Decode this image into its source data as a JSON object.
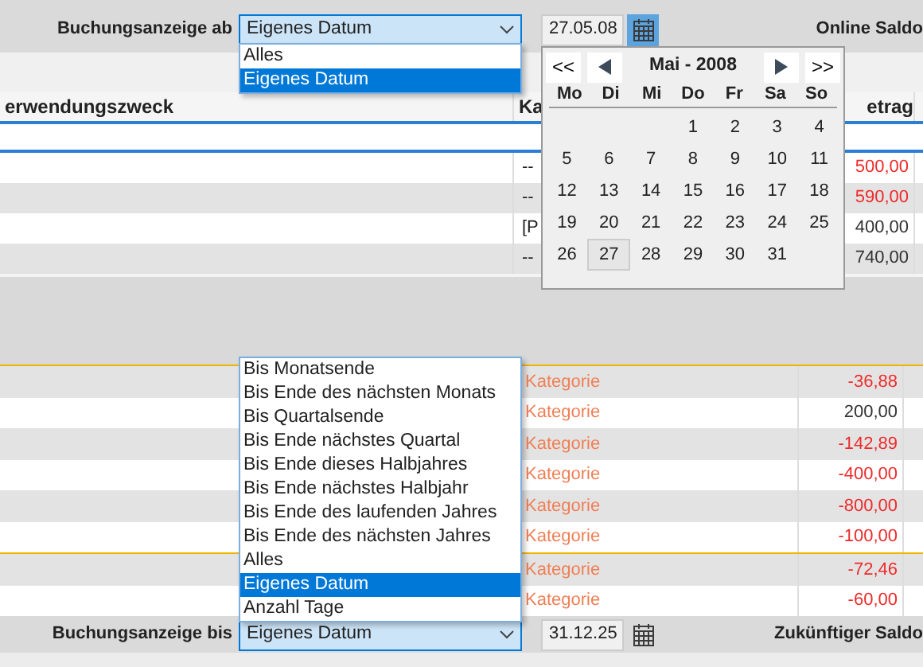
{
  "filter_from": {
    "label": "Buchungsanzeige ab",
    "value": "Eigenes Datum",
    "expanded": true,
    "date": "27.05.08",
    "saldo_label": "Online Saldo",
    "options": [
      {
        "label": "Alles",
        "selected": false
      },
      {
        "label": "Eigenes Datum",
        "selected": true
      }
    ]
  },
  "calendar": {
    "first": "<<",
    "last": ">>",
    "month_label": "Mai - 2008",
    "weekdays": [
      "Mo",
      "Di",
      "Mi",
      "Do",
      "Fr",
      "Sa",
      "So"
    ],
    "weeks": [
      {
        "days": [
          {
            "day": "1",
            "selected": false
          },
          {
            "day": "2",
            "selected": false
          },
          {
            "day": "3",
            "selected": false
          },
          {
            "day": "4",
            "selected": false
          }
        ]
      },
      {
        "days": [
          {
            "day": "5",
            "selected": false
          },
          {
            "day": "6",
            "selected": false
          },
          {
            "day": "7",
            "selected": false
          },
          {
            "day": "8",
            "selected": false
          },
          {
            "day": "9",
            "selected": false
          },
          {
            "day": "10",
            "selected": false
          },
          {
            "day": "11",
            "selected": false
          }
        ]
      },
      {
        "days": [
          {
            "day": "12",
            "selected": false
          },
          {
            "day": "13",
            "selected": false
          },
          {
            "day": "14",
            "selected": false
          },
          {
            "day": "15",
            "selected": false
          },
          {
            "day": "16",
            "selected": false
          },
          {
            "day": "17",
            "selected": false
          },
          {
            "day": "18",
            "selected": false
          }
        ]
      },
      {
        "days": [
          {
            "day": "19",
            "selected": false
          },
          {
            "day": "20",
            "selected": false
          },
          {
            "day": "21",
            "selected": false
          },
          {
            "day": "22",
            "selected": false
          },
          {
            "day": "23",
            "selected": false
          },
          {
            "day": "24",
            "selected": false
          },
          {
            "day": "25",
            "selected": false
          }
        ]
      },
      {
        "days": [
          {
            "day": "26",
            "selected": false
          },
          {
            "day": "27",
            "selected": true
          },
          {
            "day": "28",
            "selected": false
          },
          {
            "day": "29",
            "selected": false
          },
          {
            "day": "30",
            "selected": false
          },
          {
            "day": "31",
            "selected": false
          }
        ]
      }
    ]
  },
  "top_table": {
    "columns": [
      "erwendungszweck",
      "Ka",
      "etrag"
    ],
    "rows": [
      {
        "column_2": "--",
        "amount": "500,00",
        "negative": true
      },
      {
        "column_2": "--",
        "amount": "590,00",
        "negative": true
      },
      {
        "column_2": "[P",
        "amount": "400,00",
        "negative": false
      },
      {
        "column_2": "--",
        "amount": "740,00",
        "negative": false
      }
    ]
  },
  "bottom_table": {
    "groups": [
      {
        "rows": [
          {
            "category": "Kategorie",
            "amount": "-36,88",
            "negative": true
          },
          {
            "category": "Kategorie",
            "amount": "200,00",
            "negative": false
          },
          {
            "category": "Kategorie",
            "amount": "-142,89",
            "negative": true
          },
          {
            "category": "Kategorie",
            "amount": "-400,00",
            "negative": true
          },
          {
            "category": "Kategorie",
            "amount": "-800,00",
            "negative": true
          },
          {
            "category": "Kategorie",
            "amount": "-100,00",
            "negative": true
          }
        ]
      },
      {
        "rows": [
          {
            "category": "Kategorie",
            "amount": "-72,46",
            "negative": true
          },
          {
            "category": "Kategorie",
            "amount": "-60,00",
            "negative": true
          }
        ]
      }
    ]
  },
  "filter_to": {
    "label": "Buchungsanzeige bis",
    "value": "Eigenes Datum",
    "expanded": true,
    "date": "31.12.25",
    "saldo_label": "Zukünftiger Saldo",
    "options": [
      {
        "label": "Bis Monatsende",
        "selected": false
      },
      {
        "label": "Bis Ende des nächsten Monats",
        "selected": false
      },
      {
        "label": "Bis Quartalsende",
        "selected": false
      },
      {
        "label": "Bis Ende nächstes Quartal",
        "selected": false
      },
      {
        "label": "Bis Ende dieses Halbjahres",
        "selected": false
      },
      {
        "label": "Bis Ende nächstes Halbjahr",
        "selected": false
      },
      {
        "label": "Bis Ende des laufenden Jahres",
        "selected": false
      },
      {
        "label": "Bis Ende des nächsten Jahres",
        "selected": false
      },
      {
        "label": "Alles",
        "selected": false
      },
      {
        "label": "Eigenes Datum",
        "selected": true
      },
      {
        "label": "Anzahl Tage",
        "selected": false
      }
    ]
  }
}
